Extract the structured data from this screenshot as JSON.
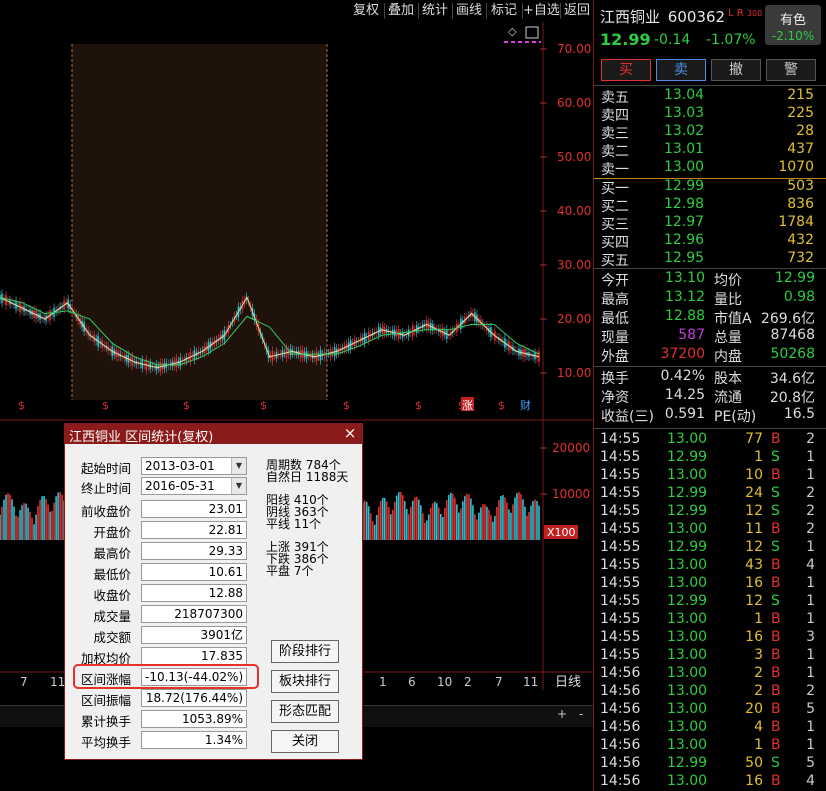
{
  "toolbar": {
    "buttons": [
      "复权",
      "叠加",
      "统计",
      "画线",
      "标记",
      "+自选",
      "返回"
    ]
  },
  "chart": {
    "price_axis": [
      "70.00",
      "60.00",
      "50.00",
      "40.00",
      "30.00",
      "20.00",
      "10.00"
    ],
    "volume_axis": [
      "20000",
      "10000"
    ],
    "volume_unit": "X100",
    "period": "日线",
    "date_ticks_left": [
      "7",
      "11"
    ],
    "date_ticks_right": [
      "1",
      "6",
      "10",
      "2",
      "7",
      "11"
    ],
    "markers": [
      "$",
      "$",
      "$",
      "$",
      "$",
      "$",
      "$",
      "涨",
      "$",
      "财"
    ],
    "zoom_in": "+",
    "zoom_out": "-",
    "scroll_left": "◀",
    "scroll_right": "▶"
  },
  "chart_data": {
    "type": "line",
    "title": "",
    "ylabel": "",
    "ylim": [
      5,
      75
    ],
    "selected_range": [
      "2013-03-01",
      "2016-05-31"
    ],
    "x": [
      0,
      5,
      10,
      15,
      20,
      25,
      30,
      35,
      40,
      45,
      50,
      55,
      60,
      65,
      70,
      75,
      80,
      85,
      90,
      95,
      100
    ],
    "series": [
      {
        "values": [
          24,
          22,
          20,
          23,
          17,
          14,
          12,
          11,
          12,
          14,
          17,
          24,
          13,
          14,
          13,
          14,
          16,
          18,
          17,
          19,
          17,
          21,
          17,
          14,
          13
        ]
      }
    ],
    "volume_ylim": [
      0,
      25000
    ]
  },
  "quote": {
    "name": "江西铜业",
    "code": "600362",
    "badge": "L R",
    "badge_sub": "300",
    "price": "12.99",
    "change": "-0.14",
    "change_pct": "-1.07%",
    "sector_name": "有色",
    "sector_change": "-2.10%",
    "buy_label": "买",
    "sell_label": "卖",
    "cancel_label": "撤",
    "alert_label": "警"
  },
  "orderbook": {
    "asks": [
      {
        "label": "卖五",
        "price": "13.04",
        "vol": "215"
      },
      {
        "label": "卖四",
        "price": "13.03",
        "vol": "225"
      },
      {
        "label": "卖三",
        "price": "13.02",
        "vol": "28"
      },
      {
        "label": "卖二",
        "price": "13.01",
        "vol": "437"
      },
      {
        "label": "卖一",
        "price": "13.00",
        "vol": "1070"
      }
    ],
    "bids": [
      {
        "label": "买一",
        "price": "12.99",
        "vol": "503"
      },
      {
        "label": "买二",
        "price": "12.98",
        "vol": "836"
      },
      {
        "label": "买三",
        "price": "12.97",
        "vol": "1784"
      },
      {
        "label": "买四",
        "price": "12.96",
        "vol": "432"
      },
      {
        "label": "买五",
        "price": "12.95",
        "vol": "732"
      }
    ]
  },
  "stats": [
    {
      "l": "今开",
      "lv": "13.10",
      "lc": "#2ecc40",
      "r": "均价",
      "rv": "12.99",
      "rc": "#2ecc40"
    },
    {
      "l": "最高",
      "lv": "13.12",
      "lc": "#2ecc40",
      "r": "量比",
      "rv": "0.98",
      "rc": "#2ecc40"
    },
    {
      "l": "最低",
      "lv": "12.88",
      "lc": "#2ecc40",
      "r": "市值A",
      "rv": "269.6亿",
      "rc": "#ddd"
    },
    {
      "l": "现量",
      "lv": "587",
      "lc": "#c040e0",
      "r": "总量",
      "rv": "87468",
      "rc": "#ddd"
    },
    {
      "l": "外盘",
      "lv": "37200",
      "lc": "#e03030",
      "r": "内盘",
      "rv": "50268",
      "rc": "#2ecc40"
    }
  ],
  "stats2": [
    {
      "l": "换手",
      "lv": "0.42%",
      "r": "股本",
      "rv": "34.6亿"
    },
    {
      "l": "净资",
      "lv": "14.25",
      "r": "流通",
      "rv": "20.8亿"
    },
    {
      "l": "收益(三)",
      "lv": "0.591",
      "r": "PE(动)",
      "rv": "16.5"
    }
  ],
  "ticks": [
    {
      "t": "14:55",
      "p": "13.00",
      "v": "77",
      "bs": "B",
      "n": "2"
    },
    {
      "t": "14:55",
      "p": "12.99",
      "v": "1",
      "bs": "S",
      "n": "1"
    },
    {
      "t": "14:55",
      "p": "13.00",
      "v": "10",
      "bs": "B",
      "n": "1"
    },
    {
      "t": "14:55",
      "p": "12.99",
      "v": "24",
      "bs": "S",
      "n": "2"
    },
    {
      "t": "14:55",
      "p": "12.99",
      "v": "12",
      "bs": "S",
      "n": "2"
    },
    {
      "t": "14:55",
      "p": "13.00",
      "v": "11",
      "bs": "B",
      "n": "2"
    },
    {
      "t": "14:55",
      "p": "12.99",
      "v": "12",
      "bs": "S",
      "n": "1"
    },
    {
      "t": "14:55",
      "p": "13.00",
      "v": "43",
      "bs": "B",
      "n": "4"
    },
    {
      "t": "14:55",
      "p": "13.00",
      "v": "16",
      "bs": "B",
      "n": "1"
    },
    {
      "t": "14:55",
      "p": "12.99",
      "v": "12",
      "bs": "S",
      "n": "1"
    },
    {
      "t": "14:55",
      "p": "13.00",
      "v": "1",
      "bs": "B",
      "n": "1"
    },
    {
      "t": "14:55",
      "p": "13.00",
      "v": "16",
      "bs": "B",
      "n": "3"
    },
    {
      "t": "14:55",
      "p": "13.00",
      "v": "3",
      "bs": "B",
      "n": "1"
    },
    {
      "t": "14:56",
      "p": "13.00",
      "v": "2",
      "bs": "B",
      "n": "1"
    },
    {
      "t": "14:56",
      "p": "13.00",
      "v": "2",
      "bs": "B",
      "n": "2"
    },
    {
      "t": "14:56",
      "p": "13.00",
      "v": "20",
      "bs": "B",
      "n": "5"
    },
    {
      "t": "14:56",
      "p": "13.00",
      "v": "4",
      "bs": "B",
      "n": "1"
    },
    {
      "t": "14:56",
      "p": "13.00",
      "v": "1",
      "bs": "B",
      "n": "1"
    },
    {
      "t": "14:56",
      "p": "12.99",
      "v": "50",
      "bs": "S",
      "n": "5"
    },
    {
      "t": "14:56",
      "p": "13.00",
      "v": "16",
      "bs": "B",
      "n": "4"
    }
  ],
  "dialog": {
    "title": "江西铜业 区间统计(复权)",
    "close": "×",
    "start_label": "起始时间",
    "start_value": "2013-03-01",
    "end_label": "终止时间",
    "end_value": "2016-05-31",
    "fields": [
      {
        "label": "前收盘价",
        "value": "23.01"
      },
      {
        "label": "开盘价",
        "value": "22.81"
      },
      {
        "label": "最高价",
        "value": "29.33"
      },
      {
        "label": "最低价",
        "value": "10.61"
      },
      {
        "label": "收盘价",
        "value": "12.88"
      },
      {
        "label": "成交量",
        "value": "218707300"
      },
      {
        "label": "成交额",
        "value": "3901亿"
      },
      {
        "label": "加权均价",
        "value": "17.835"
      },
      {
        "label": "区间涨幅",
        "value": "-10.13(-44.02%)"
      },
      {
        "label": "区间振幅",
        "value": "18.72(176.44%)"
      },
      {
        "label": "累计换手",
        "value": "1053.89%"
      },
      {
        "label": "平均换手",
        "value": "1.34%"
      }
    ],
    "stat_week": "周期数 784个",
    "stat_days": "自然日 1188天",
    "stat_up_bars": "阳线 410个",
    "stat_down_bars": "阴线 363个",
    "stat_flat_bars": "平线 11个",
    "stat_rise": "上涨 391个",
    "stat_fall": "下跌 386个",
    "stat_flat": "平盘 7个",
    "btn_stage": "阶段排行",
    "btn_sector": "板块排行",
    "btn_pattern": "形态匹配",
    "btn_close": "关闭"
  }
}
